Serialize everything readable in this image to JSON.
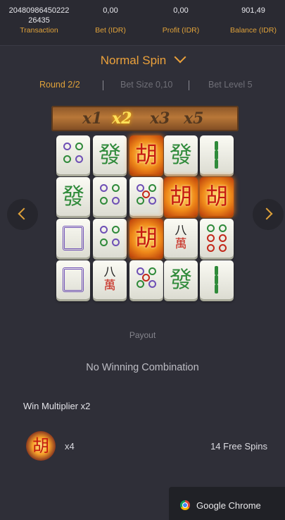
{
  "stats": {
    "transaction": {
      "value_line1": "20480986450222",
      "value_line2": "26435",
      "label": "Transaction"
    },
    "bet": {
      "value": "0,00",
      "label": "Bet (IDR)"
    },
    "profit": {
      "value": "0,00",
      "label": "Profit (IDR)"
    },
    "balance": {
      "value": "901,49",
      "label": "Balance (IDR)"
    }
  },
  "spin": {
    "title": "Normal Spin"
  },
  "round": {
    "round": "Round 2/2",
    "bet_size": "Bet Size 0,10",
    "bet_level": "Bet Level 5"
  },
  "multipliers": [
    "x1",
    "x2",
    "x3",
    "x5"
  ],
  "active_multiplier": "x2",
  "board": {
    "columns": [
      [
        "circles-4",
        "fa",
        "frame",
        "frame"
      ],
      [
        "fa",
        "circles-4",
        "circles-4",
        "wan"
      ],
      [
        "hu-gold",
        "circles-5",
        "hu-gold",
        "circles-5"
      ],
      [
        "fa",
        "hu-gold",
        "wan",
        "fa"
      ],
      [
        "bamboo",
        "hu-gold",
        "circles-6",
        "bamboo"
      ]
    ],
    "glyphs": {
      "fa": "發",
      "hu": "胡",
      "wan_top": "八",
      "wan_bottom": "萬"
    }
  },
  "payout": {
    "label": "Payout",
    "no_win": "No Winning Combination",
    "win_multiplier": "Win Multiplier x2",
    "symbol_glyph": "胡",
    "symbol_count": "x4",
    "free_spins": "14 Free Spins"
  },
  "toast": {
    "text": "Google Chrome"
  },
  "colors": {
    "accent": "#eba13b",
    "background": "#2f2f38"
  }
}
